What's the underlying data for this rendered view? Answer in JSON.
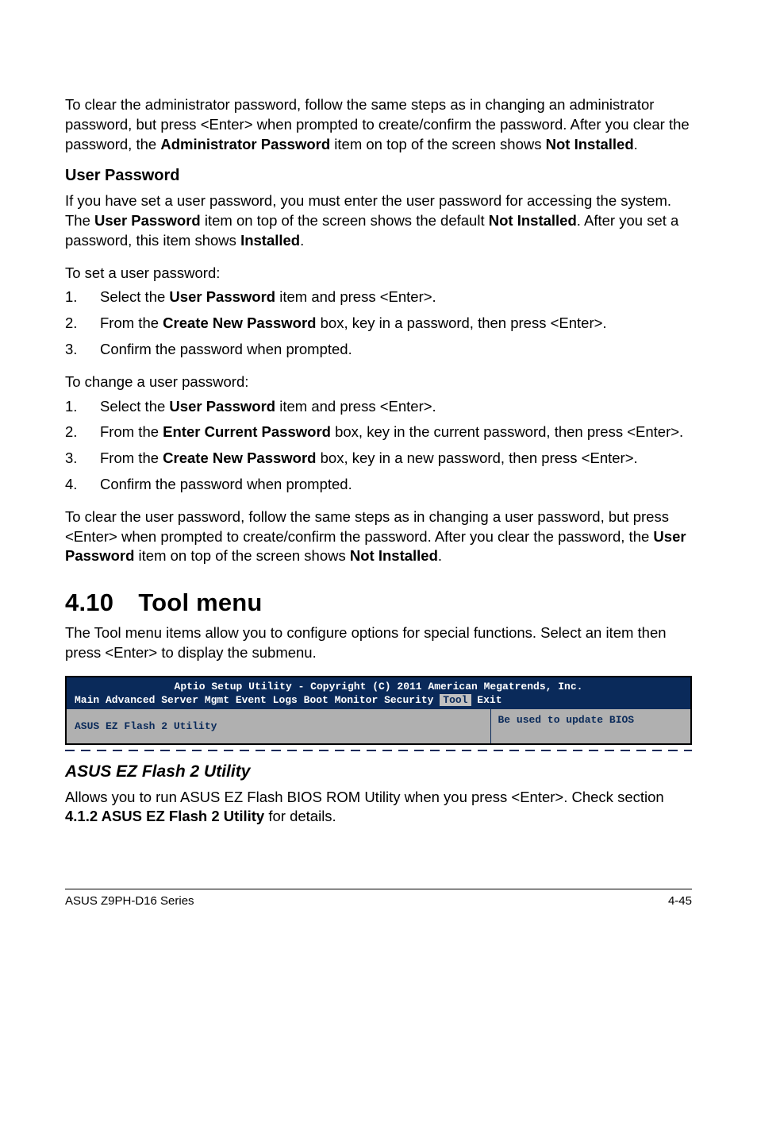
{
  "para_admin_clear": {
    "pre": "To clear the administrator password, follow the same steps as in changing an administrator password, but press <Enter> when prompted to create/confirm the password. After you clear the password, the ",
    "bold1": "Administrator Password",
    "mid": " item on top of the screen shows ",
    "bold2": "Not Installed",
    "post": "."
  },
  "user_pw_head": "User Password",
  "user_pw_intro": {
    "pre": "If you have set a user password, you must enter the user password for accessing the system. The ",
    "bold1": "User Password",
    "mid1": " item on top of the screen shows the default ",
    "bold2": "Not Installed",
    "mid2": ". After you set a password, this item shows ",
    "bold3": "Installed",
    "post": "."
  },
  "set_lead": "To set a user password:",
  "set_items": [
    {
      "num": "1.",
      "pre": "Select the ",
      "bold": "User Password",
      "post": " item and press <Enter>."
    },
    {
      "num": "2.",
      "pre": "From the ",
      "bold": "Create New Password",
      "post": " box, key in a password, then press <Enter>."
    },
    {
      "num": "3.",
      "pre": "Confirm the password when prompted.",
      "bold": "",
      "post": ""
    }
  ],
  "change_lead": "To change a user password:",
  "change_items": [
    {
      "num": "1.",
      "pre": "Select the ",
      "bold": "User Password",
      "post": " item and press <Enter>."
    },
    {
      "num": "2.",
      "pre": "From the ",
      "bold": "Enter Current Password",
      "post": " box, key in the current password, then press <Enter>."
    },
    {
      "num": "3.",
      "pre": "From the ",
      "bold": "Create New Password",
      "post": " box, key in a new password, then press <Enter>."
    },
    {
      "num": "4.",
      "pre": "Confirm the password when prompted.",
      "bold": "",
      "post": ""
    }
  ],
  "clear_user": {
    "pre": "To clear the user password, follow the same steps as in changing a user password, but press <Enter> when prompted to create/confirm the password. After you clear the password, the ",
    "bold1": "User Password",
    "mid": " item on top of the screen shows ",
    "bold2": "Not Installed",
    "post": "."
  },
  "tool_h1": "4.10 Tool menu",
  "tool_intro": "The Tool menu items allow you to configure options for special functions. Select an item then press <Enter> to display the submenu.",
  "bios": {
    "title": "Aptio Setup Utility - Copyright (C) 2011 American Megatrends, Inc.",
    "menu": "  Main  Advanced  Server Mgmt  Event Logs  Boot  Monitor  Security ",
    "menu_sel": "Tool",
    "menu_after": " Exit",
    "left": "ASUS EZ Flash 2 Utility",
    "right": "Be used to update BIOS"
  },
  "ez_head": "ASUS EZ Flash 2 Utility",
  "ez_para": {
    "pre": "Allows you to run ASUS EZ Flash BIOS ROM Utility when you press <Enter>. Check section ",
    "bold": "4.1.2 ASUS EZ Flash 2 Utility",
    "post": " for details."
  },
  "footer_left": "ASUS Z9PH-D16 Series",
  "footer_right": "4-45"
}
